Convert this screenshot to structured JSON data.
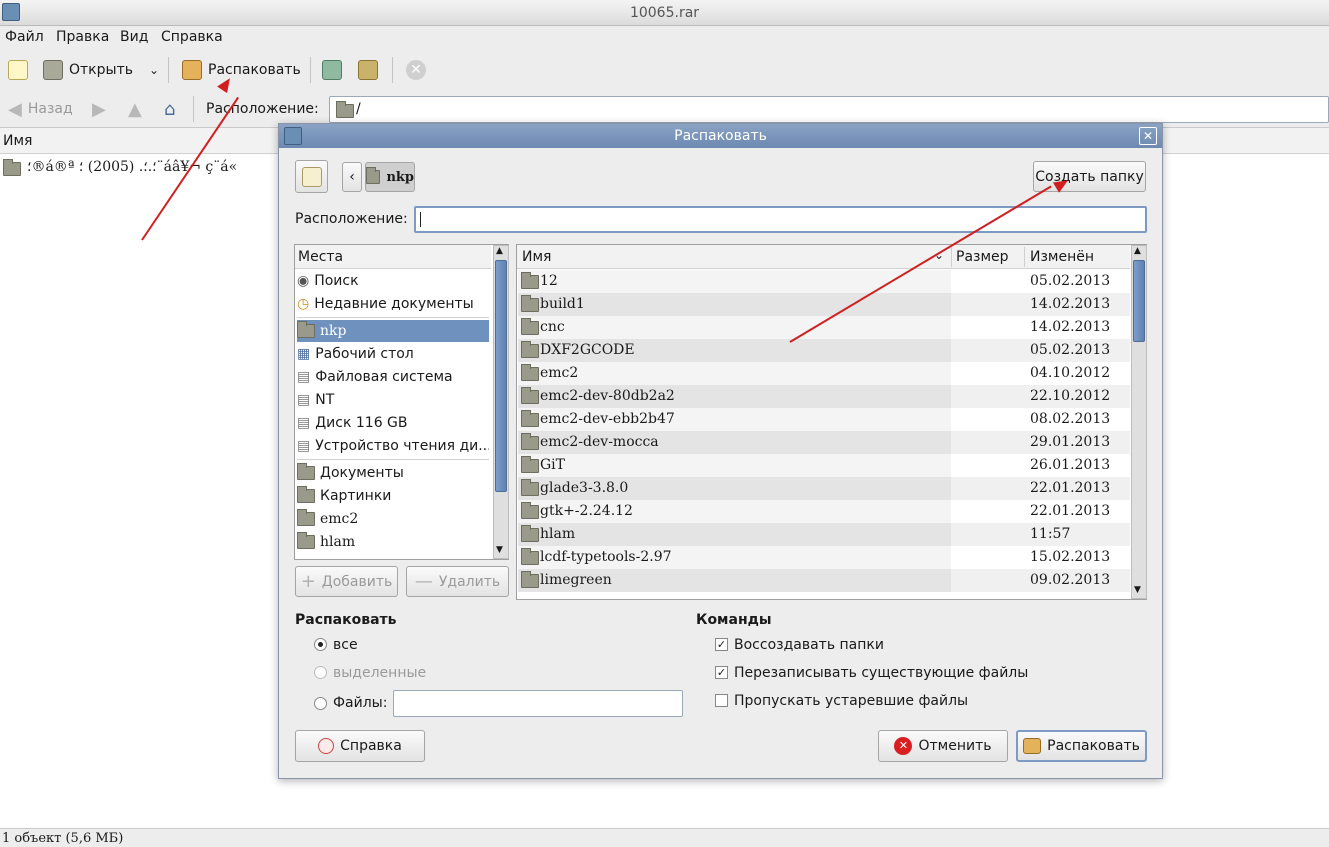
{
  "window": {
    "title": "10065.rar"
  },
  "menu": [
    "Файл",
    "Правка",
    "Вид",
    "Справка"
  ],
  "toolbar": {
    "open": "Открыть",
    "extract": "Распаковать"
  },
  "navbar": {
    "back": "Назад",
    "location_label": "Расположение:",
    "location_value": "/"
  },
  "filelist": {
    "col_name": "Имя",
    "item": "؛®á®ª ؛.؛. (2005) ؛¨áâ¥¬ ç¨á«"
  },
  "status": "1 объект (5,6 МБ)",
  "dialog": {
    "title": "Распаковать",
    "path_button": "nkp",
    "create_folder": "Создать папку",
    "location_label": "Расположение:",
    "location_value": "",
    "places_header": "Места",
    "places": [
      "Поиск",
      "Недавние документы",
      "nkp",
      "Рабочий стол",
      "Файловая система",
      "NT",
      "Диск 116 GB",
      "Устройство чтения ди...",
      "Документы",
      "Картинки",
      "emc2",
      "hlam"
    ],
    "add": "Добавить",
    "remove": "Удалить",
    "columns": {
      "name": "Имя",
      "size": "Размер",
      "modified": "Изменён"
    },
    "files": [
      {
        "name": "12",
        "date": "05.02.2013"
      },
      {
        "name": "build1",
        "date": "14.02.2013"
      },
      {
        "name": "cnc",
        "date": "14.02.2013"
      },
      {
        "name": "DXF2GCODE",
        "date": "05.02.2013"
      },
      {
        "name": "emc2",
        "date": "04.10.2012"
      },
      {
        "name": "emc2-dev-80db2a2",
        "date": "22.10.2012"
      },
      {
        "name": "emc2-dev-ebb2b47",
        "date": "08.02.2013"
      },
      {
        "name": "emc2-dev-mocca",
        "date": "29.01.2013"
      },
      {
        "name": "GiT",
        "date": "26.01.2013"
      },
      {
        "name": "glade3-3.8.0",
        "date": "22.01.2013"
      },
      {
        "name": "gtk+-2.24.12",
        "date": "22.01.2013"
      },
      {
        "name": "hlam",
        "date": "11:57"
      },
      {
        "name": "lcdf-typetools-2.97",
        "date": "15.02.2013"
      },
      {
        "name": "limegreen",
        "date": "09.02.2013"
      }
    ],
    "extract_section": "Распаковать",
    "opt_all": "все",
    "opt_selected": "выделенные",
    "opt_files": "Файлы:",
    "commands_section": "Команды",
    "cmd_recreate": "Воссоздавать папки",
    "cmd_overwrite": "Перезаписывать существующие файлы",
    "cmd_skip": "Пропускать устаревшие файлы",
    "help": "Справка",
    "cancel": "Отменить",
    "extract_button": "Распаковать"
  },
  "colors": {
    "selection": "#6f91bd",
    "titlebar": "#7a95bb",
    "annotation": "#d11e1e"
  }
}
